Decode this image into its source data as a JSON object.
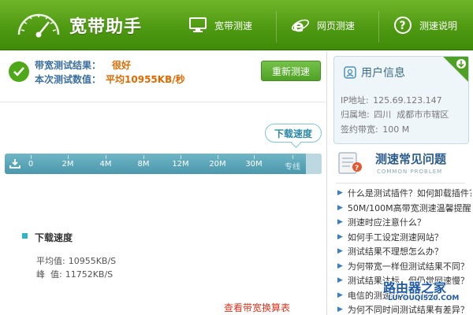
{
  "header": {
    "app_title": "宽带助手",
    "nav": [
      {
        "label": "宽带测速",
        "icon": "monitor-icon"
      },
      {
        "label": "网页测速",
        "icon": "ie-browser-icon"
      },
      {
        "label": "测速说明",
        "icon": "question-icon"
      }
    ],
    "colors": {
      "header_green": "#4f9a12",
      "accent_orange": "#e06a00",
      "bar_teal": "#4b97ab"
    }
  },
  "result": {
    "result_label": "带宽测试结果：",
    "result_value": "很好",
    "speed_label": "本次测试数值：",
    "speed_value": "平均10955KB/秒",
    "retest_button": "重新测速"
  },
  "speedometer": {
    "bubble_label": "下载速度",
    "ticks": [
      "0",
      "2M",
      "4M",
      "8M",
      "12M",
      "20M",
      "30M",
      "专线"
    ]
  },
  "download": {
    "title": "下载速度",
    "avg_label": "平均值:",
    "avg_value": "10955KB/S",
    "peak_label": "峰  值:",
    "peak_value": "11752KB/S",
    "calc_link": "查看带宽换算表"
  },
  "user_info": {
    "title": "用户信息",
    "ip_label": "IP地址:",
    "ip_value": "125.69.123.147",
    "region_label": "归属地:",
    "region_value": "四川  成都市市辖区",
    "bandwidth_label": "签约带宽:",
    "bandwidth_value": "100 M"
  },
  "faq": {
    "title": "测速常见问题",
    "subtitle": "COMMON PROBLEM",
    "items": [
      "什么是测试插件？如何卸载插件？",
      "50M/100M高带宽测速温馨提醒",
      "测速时应注意什么？",
      "如何手工设定测速网站？",
      "测试结果不理想怎么办？",
      "为何带宽一样但测试结果不同？",
      "测试结果达标，但仍觉网速慢？",
      "电信的测速结果可信吗？",
      "为何不同时间测试结果有差异？"
    ]
  },
  "watermark": {
    "line1": "路由器之家",
    "line2": "LUYOUQI520.COM"
  }
}
